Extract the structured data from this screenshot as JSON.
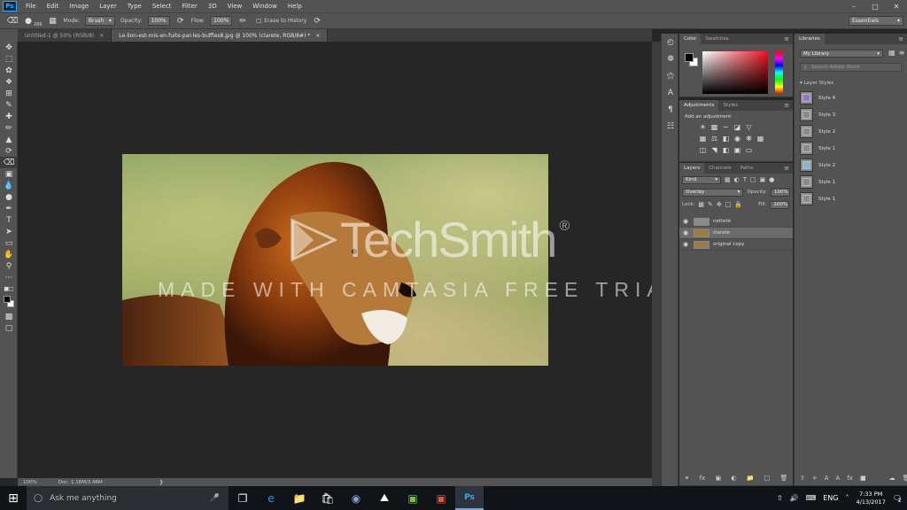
{
  "menu": [
    "File",
    "Edit",
    "Image",
    "Layer",
    "Type",
    "Select",
    "Filter",
    "3D",
    "View",
    "Window",
    "Help"
  ],
  "options": {
    "mode_label": "Mode:",
    "mode_value": "Brush",
    "opacity_label": "Opacity:",
    "opacity_value": "100%",
    "flow_label": "Flow:",
    "flow_value": "100%",
    "erase_history_label": "Erase to History",
    "brush_size": "286",
    "workspace": "Essentials"
  },
  "tabs": [
    {
      "label": "Untitled-1 @ 50% (RGB/8)"
    },
    {
      "label": "Le-lion-est-mis-en-fuite-par-les-buffles8.jpg @ 100% (clarete, RGB/8#) *"
    }
  ],
  "status": {
    "zoom": "100%",
    "doc": "Doc: 1.16M/3.46M"
  },
  "watermark": {
    "brand": "TechSmith",
    "reg": "®",
    "line": "MADE WITH CAMTASIA FREE TRIAL"
  },
  "color_panel": {
    "tabs": [
      "Color",
      "Swatches"
    ]
  },
  "adjust_panel": {
    "tabs": [
      "Adjustments",
      "Styles"
    ],
    "title": "Add an adjustment"
  },
  "layers_panel": {
    "tabs": [
      "Layers",
      "Channels",
      "Paths"
    ],
    "kind": "Kind",
    "blend": "Overlay",
    "opacity_label": "Opacity:",
    "opacity": "100%",
    "lock_label": "Lock:",
    "fill_label": "Fill:",
    "fill": "100%",
    "layers": [
      {
        "name": "netteté",
        "thumb": "#8a8a8a"
      },
      {
        "name": "clarete",
        "thumb": "#9b7a45"
      },
      {
        "name": "original copy",
        "thumb": "#9b7a45"
      }
    ]
  },
  "libraries": {
    "tab": "Libraries",
    "library": "My Library",
    "search": "Search Adobe Stock",
    "section": "Layer Styles",
    "styles": [
      "Style 4",
      "Style 3",
      "Style 2",
      "Style 1",
      "Style 2",
      "Style 1",
      "Style 1"
    ],
    "style_colors": [
      "#9b6fd0",
      "#8a8a8a",
      "#8a8a8a",
      "#8a8a8a",
      "#7bbbd8",
      "#8a8a8a",
      "#8a8a8a"
    ]
  },
  "taskbar": {
    "search": "Ask me anything",
    "time": "7:33 PM",
    "date": "4/13/2017",
    "lang": "ENG",
    "notifications": "2"
  }
}
